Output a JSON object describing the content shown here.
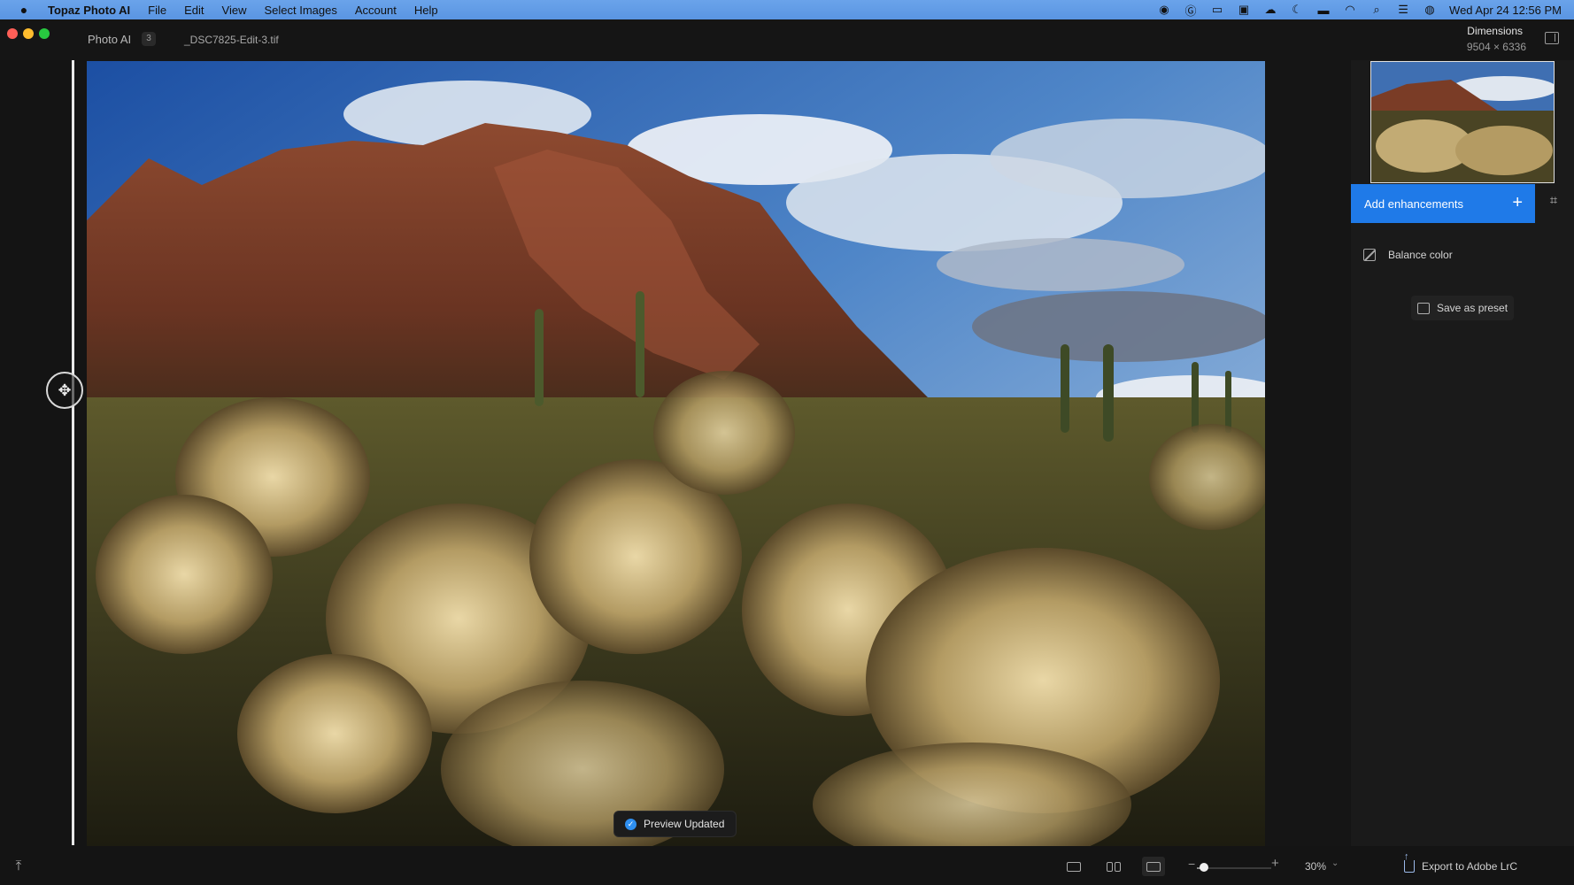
{
  "menubar": {
    "app_name": "Topaz Photo AI",
    "menus": [
      "File",
      "Edit",
      "View",
      "Select Images",
      "Account",
      "Help"
    ],
    "clock": "Wed Apr 24  12:56 PM"
  },
  "titlebar": {
    "app_label": "Photo AI",
    "image_count": "3",
    "file_name": "_DSC7825-Edit-3.tif",
    "dimensions_label": "Dimensions",
    "dimensions_value": "9504 × 6336"
  },
  "sidebar": {
    "add_enhancements_label": "Add enhancements",
    "enhancements": [
      {
        "label": "Balance color",
        "icon": "balance-color-icon"
      }
    ],
    "save_preset_label": "Save as preset"
  },
  "canvas": {
    "toast_label": "Preview Updated"
  },
  "bottombar": {
    "zoom_value": "30%",
    "zoom_level": 0.1,
    "export_label": "Export to Adobe LrC"
  },
  "colors": {
    "accent": "#1f7ae8",
    "menubar": "#5a95e2",
    "window_bg": "#151515"
  }
}
